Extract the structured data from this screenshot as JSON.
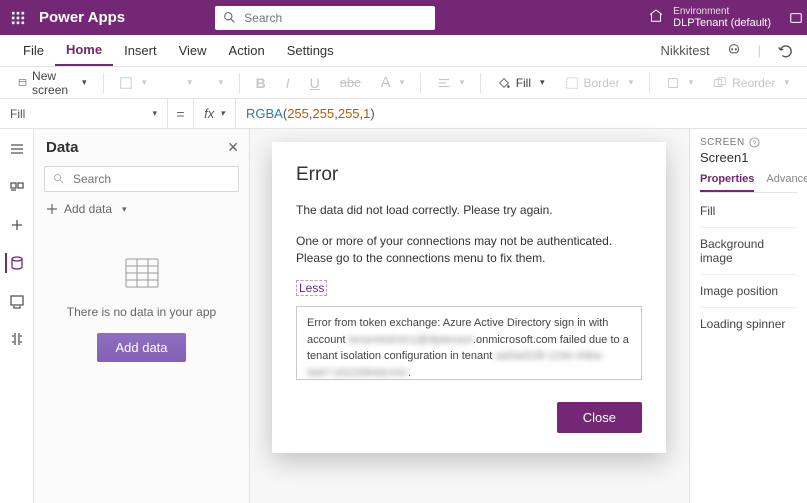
{
  "titlebar": {
    "app_name": "Power Apps",
    "search_placeholder": "Search",
    "env_label": "Environment",
    "env_name": "DLPTenant (default)"
  },
  "menu": {
    "items": [
      "File",
      "Home",
      "Insert",
      "View",
      "Action",
      "Settings"
    ],
    "active_index": 1,
    "user": "Nikkitest"
  },
  "ribbon": {
    "new_screen": "New screen",
    "fill": "Fill",
    "border": "Border",
    "reorder": "Reorder"
  },
  "formula": {
    "property": "Fill",
    "fx": "fx",
    "eq": "=",
    "func": "RGBA",
    "args": [
      "255",
      "255",
      "255",
      "1"
    ]
  },
  "data_panel": {
    "title": "Data",
    "search_placeholder": "Search",
    "add_data": "Add data",
    "empty_msg": "There is no data in your app",
    "add_btn": "Add data"
  },
  "prop_panel": {
    "screen_label": "SCREEN",
    "screen_name": "Screen1",
    "tabs": [
      "Properties",
      "Advanced"
    ],
    "active_tab": 0,
    "rows": [
      "Fill",
      "Background image",
      "Image position",
      "Loading spinner"
    ]
  },
  "modal": {
    "title": "Error",
    "line1": "The data did not load correctly. Please try again.",
    "line2": "One or more of your connections may not be authenticated. Please go to the connections menu to fix them.",
    "toggle": "Less",
    "detail_pre": "Error from token exchange: Azure Active Directory sign in with account ",
    "detail_mid": ".onmicrosoft.com failed due to a tenant isolation configuration in tenant ",
    "close": "Close"
  }
}
